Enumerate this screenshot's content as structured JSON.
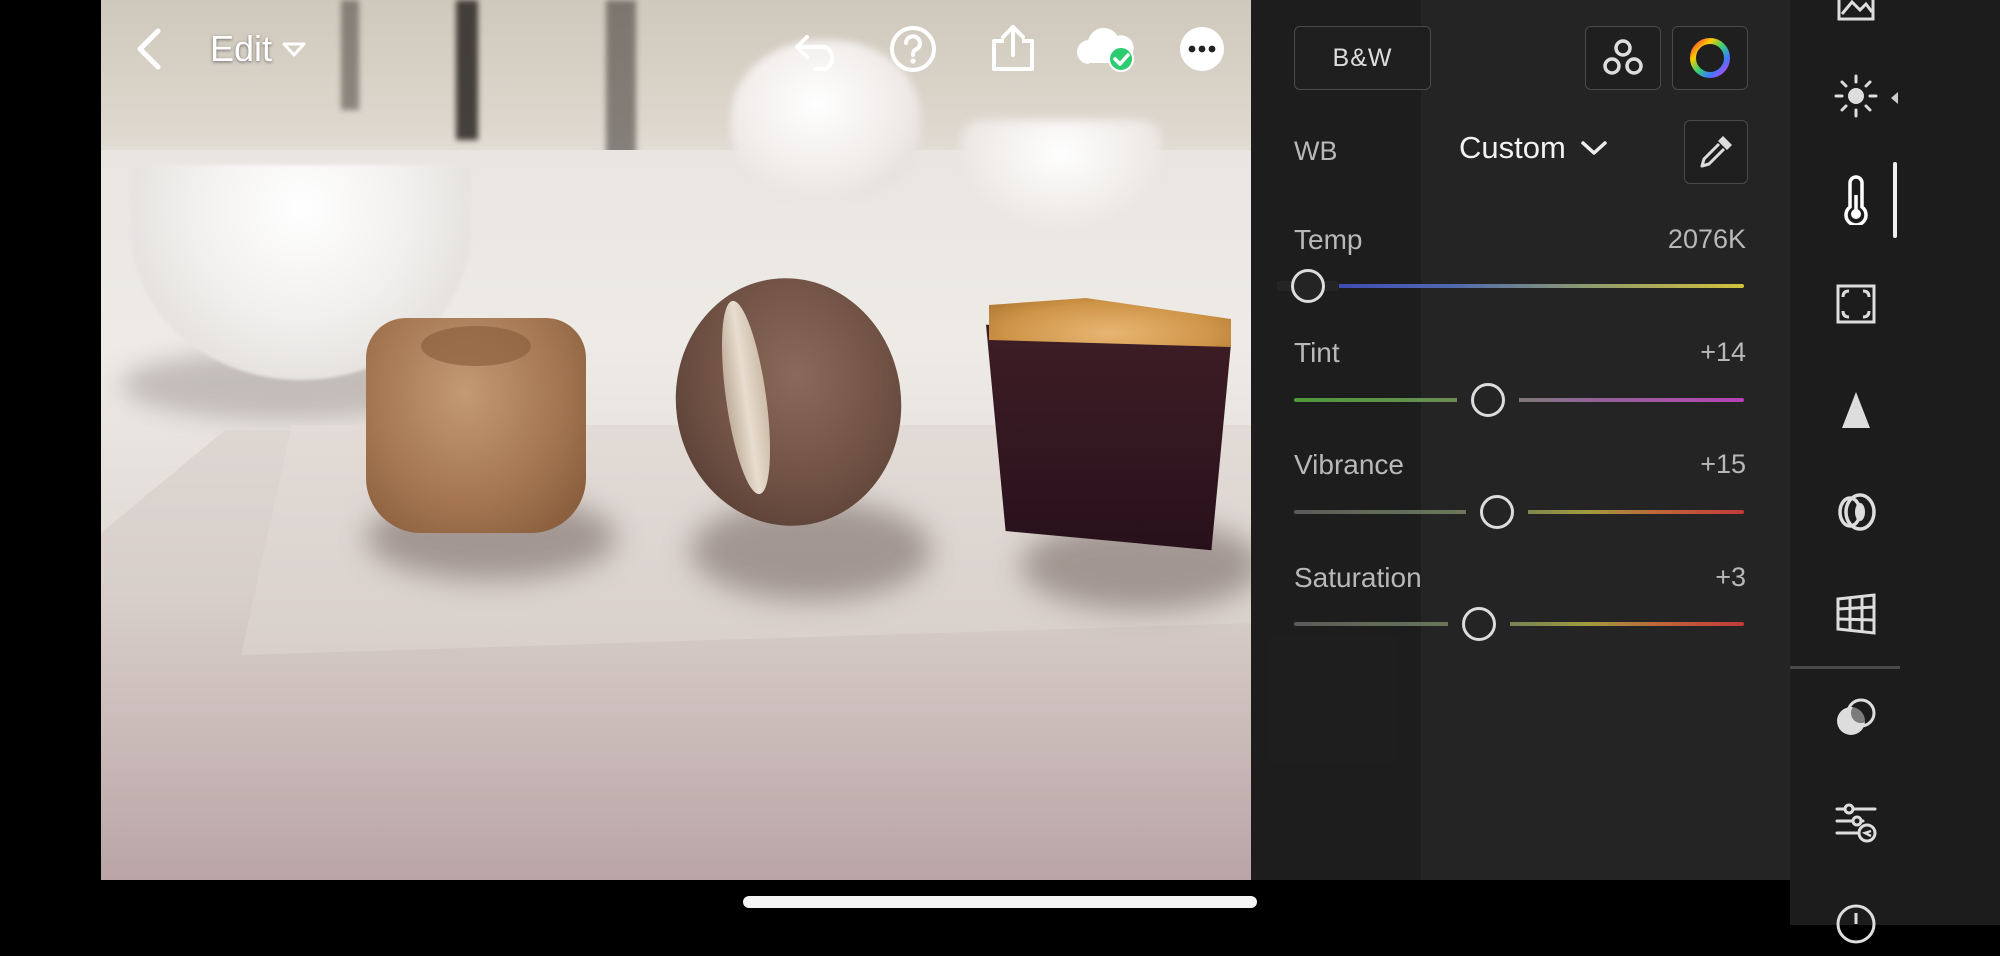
{
  "toolbar": {
    "edit_label": "Edit",
    "icons": [
      "back-icon",
      "chevron-down-icon",
      "undo-icon",
      "help-icon",
      "share-icon",
      "cloud-synced-icon",
      "more-icon"
    ]
  },
  "panel": {
    "bw_label": "B&W",
    "wb_label": "WB",
    "wb_value": "Custom",
    "sliders": {
      "temp": {
        "label": "Temp",
        "value": "2076K",
        "position": 0.03
      },
      "tint": {
        "label": "Tint",
        "value": "+14",
        "position": 0.43
      },
      "vibrance": {
        "label": "Vibrance",
        "value": "+15",
        "position": 0.45
      },
      "saturation": {
        "label": "Saturation",
        "value": "+3",
        "position": 0.41
      }
    }
  },
  "rail": {
    "icons": [
      "image-icon",
      "light-icon",
      "color-thermometer-icon",
      "effects-icon",
      "detail-icon",
      "optics-icon",
      "geometry-icon",
      "masking-icon",
      "presets-icon",
      "versions-icon"
    ],
    "active": "color-thermometer-icon"
  },
  "colors": {
    "panel_bg": "#242424",
    "rail_bg": "#1c1c1c",
    "accent": "#2ecc71"
  }
}
